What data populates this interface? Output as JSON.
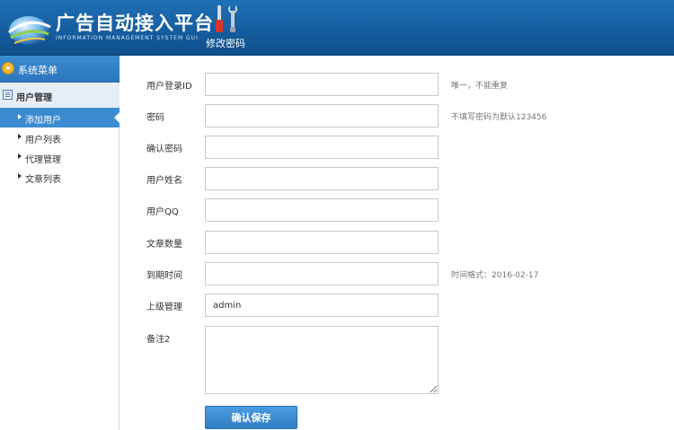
{
  "header": {
    "title": "广告自动接入平台",
    "subtitle": "INFORMATION MANAGEMENT SYSTEM GUI",
    "tools": [
      {
        "label": "修改密码",
        "icon": "tools-icon"
      }
    ]
  },
  "sidebar": {
    "menu_title": "系统菜单",
    "group_title": "用户管理",
    "items": [
      {
        "label": "添加用户",
        "active": true
      },
      {
        "label": "用户列表",
        "active": false
      },
      {
        "label": "代理管理",
        "active": false
      },
      {
        "label": "文章列表",
        "active": false
      }
    ]
  },
  "form": {
    "fields": [
      {
        "label": "用户登录ID",
        "value": "",
        "hint": "唯一，不能重复"
      },
      {
        "label": "密码",
        "value": "",
        "hint": "不填写密码为默认123456"
      },
      {
        "label": "确认密码",
        "value": "",
        "hint": ""
      },
      {
        "label": "用户姓名",
        "value": "",
        "hint": ""
      },
      {
        "label": "用户QQ",
        "value": "",
        "hint": ""
      },
      {
        "label": "文章数量",
        "value": "",
        "hint": ""
      },
      {
        "label": "到期时间",
        "value": "",
        "hint": "时间格式：2016-02-17"
      },
      {
        "label": "上级管理",
        "value": "admin",
        "hint": ""
      }
    ],
    "remarks_label": "备注2",
    "remarks_value": "",
    "submit_label": "确认保存"
  },
  "colors": {
    "header_bg": "#165ea0",
    "accent": "#3b8bd0",
    "button": "#2f7fc5"
  }
}
